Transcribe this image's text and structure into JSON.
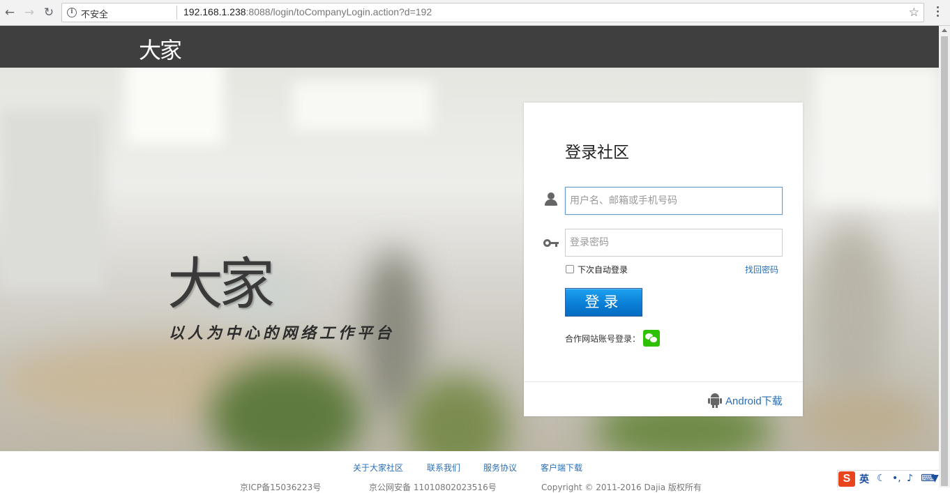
{
  "browser": {
    "not_secure_label": "不安全",
    "url_host": "192.168.1.238",
    "url_rest": ":8088/login/toCompanyLogin.action?d=192",
    "back_icon": "←",
    "forward_icon": "→",
    "reload_icon": "↻",
    "star_icon": "☆"
  },
  "header": {
    "logo": "大家"
  },
  "hero": {
    "brand": "大家",
    "slogan": "以人为中心的网络工作平台"
  },
  "login": {
    "title": "登录社区",
    "username_placeholder": "用户名、邮箱或手机号码",
    "password_placeholder": "登录密码",
    "remember_label": "下次自动登录",
    "forgot_label": "找回密码",
    "submit_label": "登录",
    "partner_label": "合作网站账号登录：",
    "android_label": "Android下载"
  },
  "footer": {
    "links": [
      "关于大家社区",
      "联系我们",
      "服务协议",
      "客户端下载"
    ],
    "icp": "京ICP备15036223号",
    "police": "京公网安备 11010802023516号",
    "copyright": "Copyright © 2011-2016 Dajia 版权所有"
  },
  "ime": {
    "logo": "S",
    "lang": "英"
  },
  "colors": {
    "topbar": "#3f3f3f",
    "accent_blue": "#0a7fd6",
    "link_blue": "#2a6fb5",
    "wechat_green": "#2dc100"
  }
}
